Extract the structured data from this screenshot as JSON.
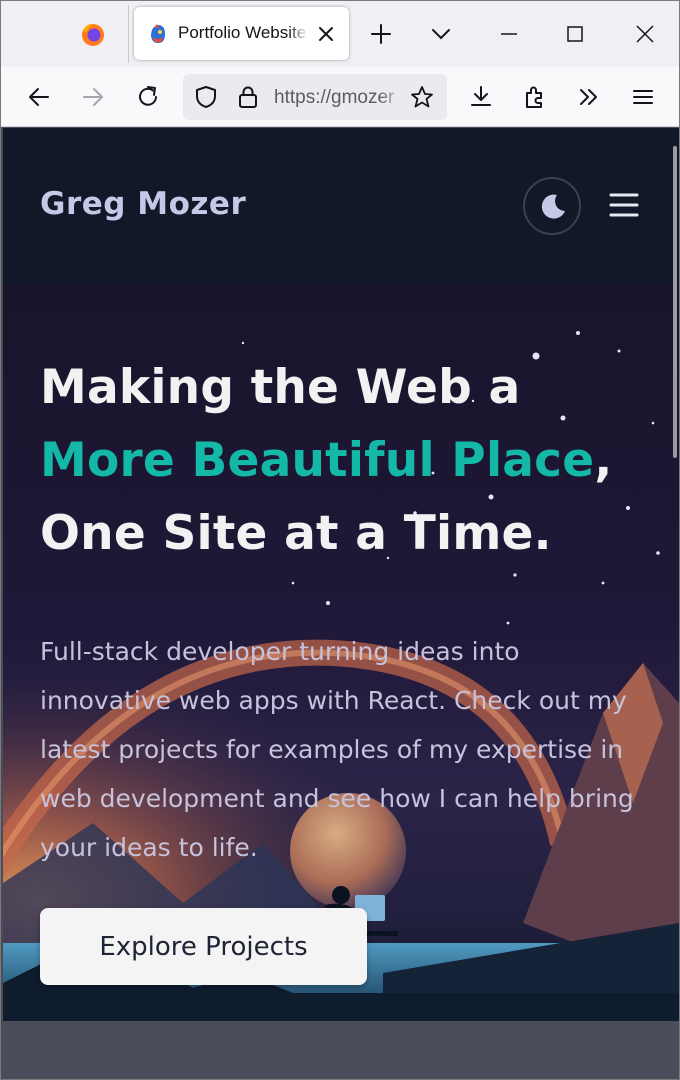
{
  "browser": {
    "tab": {
      "title": "Portfolio Website"
    },
    "url": "https://gmozer",
    "icons": [
      "firefox-logo-icon",
      "tab-favicon-icon",
      "close-tab-icon",
      "new-tab-icon",
      "list-tabs-icon",
      "minimize-icon",
      "maximize-icon",
      "close-window-icon",
      "back-icon",
      "forward-icon",
      "reload-icon",
      "shield-icon",
      "lock-icon",
      "bookmark-star-icon",
      "downloads-icon",
      "extensions-icon",
      "overflow-chevrons-icon",
      "hamburger-menu-icon"
    ]
  },
  "site": {
    "brand": "Greg Mozer",
    "headline": {
      "line1": "Making the Web a",
      "accent": "More Beautiful Place",
      "comma": ",",
      "line3": "One Site at a Time."
    },
    "tagline": "Full-stack developer turning ideas into innovative web apps with React. Check out my latest projects for examples of my expertise in web development and see how I can help bring your ideas to life.",
    "cta_label": "Explore Projects",
    "icons": [
      "moon-icon",
      "menu-icon"
    ]
  },
  "colors": {
    "header_bg": "#111827",
    "accent": "#14b8a6",
    "brand_text": "#c5c9e8",
    "tagline_text": "#c7c2dc"
  }
}
